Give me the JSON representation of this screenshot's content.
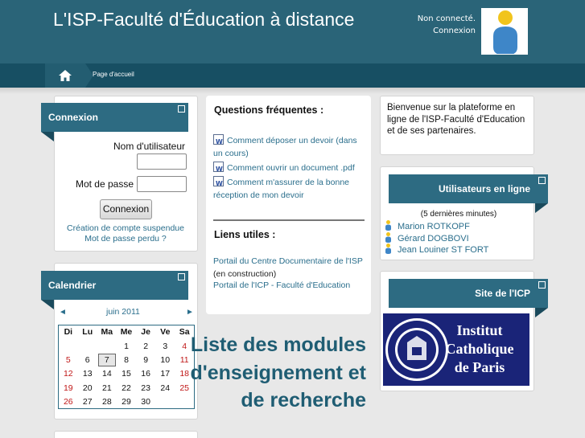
{
  "header": {
    "site_title": "L'ISP-Faculté d'Éducation à distance",
    "login_status": "Non connecté.",
    "login_link": "Connexion"
  },
  "navbar": {
    "home_icon": "home-icon",
    "breadcrumb": "Page d'accueil"
  },
  "login_block": {
    "title": "Connexion",
    "username_label": "Nom d'utilisateur",
    "password_label": "Mot de passe",
    "username_value": "",
    "password_value": "",
    "submit_label": "Connexion",
    "links": [
      "Création de compte suspendue",
      "Mot de passe perdu ?"
    ]
  },
  "calendar_block": {
    "title": "Calendrier",
    "prev": "◄",
    "month": "juin 2011",
    "next": "►",
    "weekdays": [
      "Di",
      "Lu",
      "Ma",
      "Me",
      "Je",
      "Ve",
      "Sa"
    ],
    "weeks": [
      [
        "",
        "",
        "",
        "1",
        "2",
        "3",
        "4"
      ],
      [
        "5",
        "6",
        "7",
        "8",
        "9",
        "10",
        "11"
      ],
      [
        "12",
        "13",
        "14",
        "15",
        "16",
        "17",
        "18"
      ],
      [
        "19",
        "20",
        "21",
        "22",
        "23",
        "24",
        "25"
      ],
      [
        "26",
        "27",
        "28",
        "29",
        "30",
        "",
        ""
      ]
    ],
    "today": "7"
  },
  "center": {
    "faq_title": "Questions fréquentes :",
    "faq_links": [
      "Comment déposer un devoir (dans un cours)",
      "Comment ouvrir un document .pdf",
      "Comment m'assurer de la bonne réception de mon devoir"
    ],
    "useful_title": "Liens utiles :",
    "useful_links": [
      {
        "link": "Portail du Centre Documentaire de l'ISP",
        "suffix": " (en construction)"
      },
      {
        "link": "Portail de l'ICP - Faculté d'Education",
        "suffix": ""
      }
    ],
    "modules_title": "Liste des modules d'enseignement et de recherche"
  },
  "welcome_block": {
    "text": "Bienvenue sur la plateforme en ligne de l'ISP-Faculté d'Education et de ses partenaires."
  },
  "online_block": {
    "title": "Utilisateurs en ligne",
    "subtitle": "(5 dernières minutes)",
    "users": [
      "Marion ROTKOPF",
      "Gérard DOGBOVI",
      "Jean Louiner ST FORT"
    ]
  },
  "icp_block": {
    "title": "Site de l'ICP",
    "logo_text": [
      "Institut",
      "Catholique",
      "de Paris"
    ]
  },
  "colors": {
    "header_bg": "#2a6478",
    "navbar_bg": "#174f63",
    "block_title_bg": "#2d6b82",
    "link": "#2a6e8c",
    "weekend": "#c01818"
  }
}
